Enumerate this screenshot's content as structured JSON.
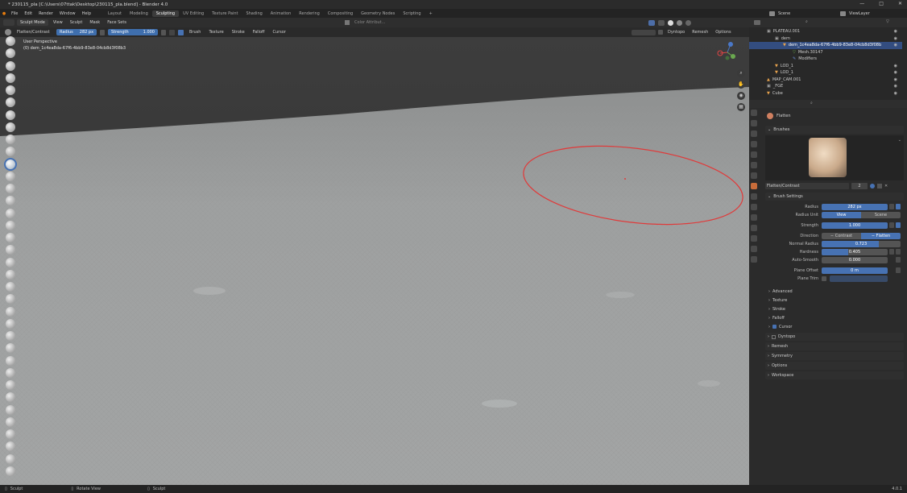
{
  "window": {
    "title": "* 230115_pla [C:\\Users\\07ttak\\Desktop\\230115_pla.blend] - Blender 4.0",
    "controls": [
      "—",
      "□",
      "✕"
    ]
  },
  "menu": {
    "items": [
      "File",
      "Edit",
      "Render",
      "Window",
      "Help"
    ]
  },
  "workspaces": {
    "tabs": [
      "Layout",
      "Modeling",
      "Sculpting",
      "UV Editing",
      "Texture Paint",
      "Shading",
      "Animation",
      "Rendering",
      "Compositing",
      "Geometry Nodes",
      "Scripting"
    ],
    "active": "Sculpting",
    "add": "+"
  },
  "scene": {
    "label": "Scene",
    "view_layer": "ViewLayer"
  },
  "header": {
    "mode": "Sculpt Mode",
    "menus": [
      "View",
      "Sculpt",
      "Mask",
      "Face Sets"
    ],
    "brush_name": "Flatten/Contrast",
    "radius_label": "Radius",
    "radius_value": "282 px",
    "strength_label": "Strength",
    "strength_value": "1.000",
    "dropdowns": [
      "Brush",
      "Texture",
      "Stroke",
      "Falloff",
      "Cursor"
    ],
    "color_attribute": "Color Attribut...",
    "right_items": [
      "Dyntopo",
      "Remesh",
      "Options"
    ]
  },
  "viewport": {
    "perspective": "User Perspective",
    "object": "(0) dem_1c4ea8da-67f6-4bb9-83e8-04cb8d3f08b3"
  },
  "outliner": {
    "rows": [
      {
        "indent": 0,
        "label": "PLATEAU.001"
      },
      {
        "indent": 1,
        "label": "dem"
      },
      {
        "indent": 2,
        "label": "dem_1c4ea8da-67f6-4bb9-83e8-04cb8d3f08b",
        "selected": true
      },
      {
        "indent": 3,
        "label": "Mesh.30147"
      },
      {
        "indent": 3,
        "label": "Modifiers"
      },
      {
        "indent": 1,
        "label": "LOD_1"
      },
      {
        "indent": 1,
        "label": "LOD_1"
      },
      {
        "indent": 0,
        "label": "MAP_CAM.001"
      },
      {
        "indent": 0,
        "label": "_FGE"
      },
      {
        "indent": 0,
        "label": "Cube"
      }
    ]
  },
  "properties": {
    "brush_title": "Flatten",
    "brushes_section": "Brushes",
    "brush_slot": "Flatten/Contrast",
    "brush_users": "2",
    "brush_settings_section": "Brush Settings",
    "radius": {
      "label": "Radius",
      "value": "282 px"
    },
    "radius_unit": {
      "label": "Radius Unit",
      "options": [
        "View",
        "Scene"
      ],
      "active": "View"
    },
    "strength": {
      "label": "Strength",
      "value": "1.000"
    },
    "direction": {
      "label": "Direction",
      "options": [
        "Contrast",
        "Flatten"
      ],
      "active": "Flatten"
    },
    "normal_radius": {
      "label": "Normal Radius",
      "value": "0.723"
    },
    "hardness": {
      "label": "Hardness",
      "value": "0.405"
    },
    "auto_smooth": {
      "label": "Auto-Smooth",
      "value": "0.000"
    },
    "plane_offset": {
      "label": "Plane Offset",
      "value": "0 m"
    },
    "plane_trim": {
      "label": "Plane Trim",
      "value": ""
    },
    "subpanels": [
      "Advanced",
      "Texture",
      "Stroke",
      "Falloff",
      "Cursor"
    ],
    "panels": [
      "Dyntopo",
      "Remesh",
      "Symmetry",
      "Options",
      "Workspace"
    ]
  },
  "status": {
    "items": [
      "Sculpt",
      "Rotate View",
      "Sculpt"
    ],
    "version": "4.0.1"
  },
  "colors": {
    "accent": "#4772b3",
    "selected_row": "#334d80",
    "brush_circle": "#e03a3a"
  },
  "levels": {
    "strength": 1.0,
    "normal_radius": 0.723,
    "hardness": 0.405,
    "auto_smooth": 0.0
  }
}
